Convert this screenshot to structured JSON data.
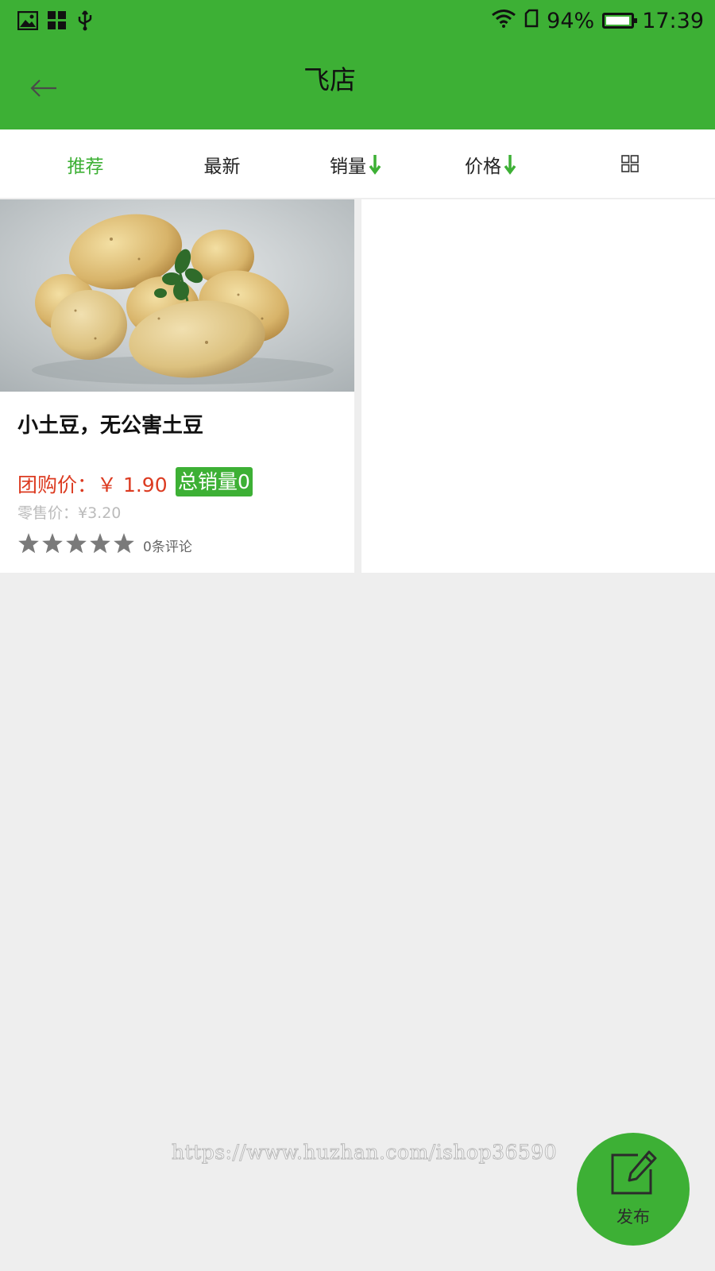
{
  "status_bar": {
    "battery": "94%",
    "time": "17:39"
  },
  "header": {
    "title": "飞店"
  },
  "sort_tabs": [
    {
      "label": "推荐",
      "active": true
    },
    {
      "label": "最新"
    },
    {
      "label": "销量",
      "icon": "down-arrow-icon"
    },
    {
      "label": "价格",
      "icon": "down-arrow-icon"
    }
  ],
  "layout_toggle": {
    "icon": "grid-icon"
  },
  "products": [
    {
      "name": "小土豆，无公害土豆",
      "group_price": "团购价：￥ 1.90",
      "sales": "总销量0",
      "retail_price": "零售价：¥3.20",
      "rating": 5,
      "reviews": "0条评论"
    }
  ],
  "watermark": "https://www.huzhan.com/ishop36590",
  "fab": {
    "label": "发布",
    "icon": "edit-icon"
  },
  "colors": {
    "brand": "#3db035",
    "price": "#dc3b21",
    "background": "#eeeeee"
  }
}
